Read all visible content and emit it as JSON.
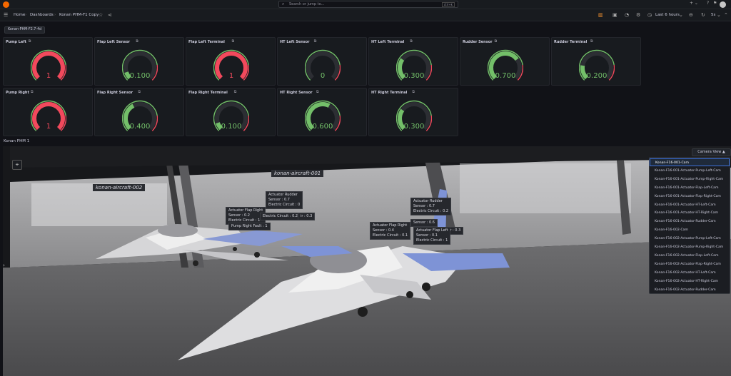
{
  "topbar": {
    "search_placeholder": "Search or jump to...",
    "search_kbd": "ctrl+k",
    "add_label": "+ ⌄"
  },
  "breadcrumb": {
    "home": "Home",
    "dashboards": "Dashboards",
    "current": "Konan PHM-F1 Copy"
  },
  "toolbar": {
    "time_range": "Last 6 hours",
    "refresh": "5s"
  },
  "variable_chip": "Konan-PHM-F2.7-4d",
  "panels": [
    {
      "title": "Pump Left",
      "value": "1",
      "fraction": 1.0,
      "color": "#f2495c"
    },
    {
      "title": "Flap Left Sensor",
      "value": "0.100",
      "fraction": 0.1,
      "color": "#73bf69"
    },
    {
      "title": "Flap Left Terminal",
      "value": "1",
      "fraction": 1.0,
      "color": "#f2495c"
    },
    {
      "title": "HT Left Sensor",
      "value": "0",
      "fraction": 0.0,
      "color": "#73bf69"
    },
    {
      "title": "HT Left Terminal",
      "value": "0.300",
      "fraction": 0.3,
      "color": "#73bf69"
    },
    {
      "title": "Rudder Sensor",
      "value": "0.700",
      "fraction": 0.7,
      "color": "#73bf69"
    },
    {
      "title": "Rudder Terminal",
      "value": "0.200",
      "fraction": 0.2,
      "color": "#73bf69"
    },
    {
      "title": "Pump Right",
      "value": "1",
      "fraction": 1.0,
      "color": "#f2495c"
    },
    {
      "title": "Flap Right Sensor",
      "value": "0.400",
      "fraction": 0.4,
      "color": "#73bf69"
    },
    {
      "title": "Flap Right Terminal",
      "value": "0.100",
      "fraction": 0.1,
      "color": "#73bf69"
    },
    {
      "title": "HT Right Sensor",
      "value": "0.600",
      "fraction": 0.6,
      "color": "#73bf69"
    },
    {
      "title": "HT Right Terminal",
      "value": "0.300",
      "fraction": 0.3,
      "color": "#73bf69"
    }
  ],
  "row_title": "Konan PHM 1",
  "camera_view": {
    "label": "Camera View ▲",
    "options": [
      "Konan-F16-001-Cam",
      "Konan-F16-001-Actuator-Pump-Left-Cam",
      "Konan-F16-001-Actuator-Pump-Right-Cam",
      "Konan-F16-001-Actuator-Flap-Left-Cam",
      "Konan-F16-001-Actuator-Flap-Right-Cam",
      "Konan-F16-001-Actuator-HT-Left-Cam",
      "Konan-F16-001-Actuator-HT-Right-Cam",
      "Konan-F16-001-Actuator-Rudder-Cam",
      "Konan-F16-002-Cam",
      "Konan-F16-002-Actuator-Pump-Left-Cam",
      "Konan-F16-002-Actuator-Pump-Right-Cam",
      "Konan-F16-002-Actuator-Flap-Left-Cam",
      "Konan-F16-002-Actuator-Flap-Right-Cam",
      "Konan-F16-002-Actuator-HT-Left-Cam",
      "Konan-F16-002-Actuator-HT-Right-Cam",
      "Konan-F16-002-Actuator-Rudder-Cam"
    ]
  },
  "scene": {
    "aircraft_a": "konan-aircraft-002",
    "aircraft_b": "konan-aircraft-001",
    "labels": {
      "a_flap_right": [
        "Actuator Flap Right",
        "Sensor : 0.2",
        "Electric Circuit : 1"
      ],
      "a_rudder": [
        "Actuator Rudder",
        "Sensor : 0.7",
        "Electric Circuit : 0"
      ],
      "a_pump": [
        "Pump Right Fault : 1"
      ],
      "a_ec": [
        "Electric Circuit : 0.2"
      ],
      "a_ec2": [
        "ir : 0.3"
      ],
      "b_rudder": [
        "Actuator Rudder",
        "Sensor : 0.7",
        "Electric Circuit : 0.2"
      ],
      "b_flap_right": [
        "Actuator Flap Right",
        "Sensor : 0.4",
        "Electric Circuit : 0.1"
      ],
      "b_flap_left": [
        "Actuator Flap Left",
        "Sensor : 0.1",
        "Electric Circuit : 1"
      ],
      "b_sensor": [
        "Sensor : 0.6"
      ],
      "b_ir": [
        "ir : 0.3"
      ]
    }
  }
}
